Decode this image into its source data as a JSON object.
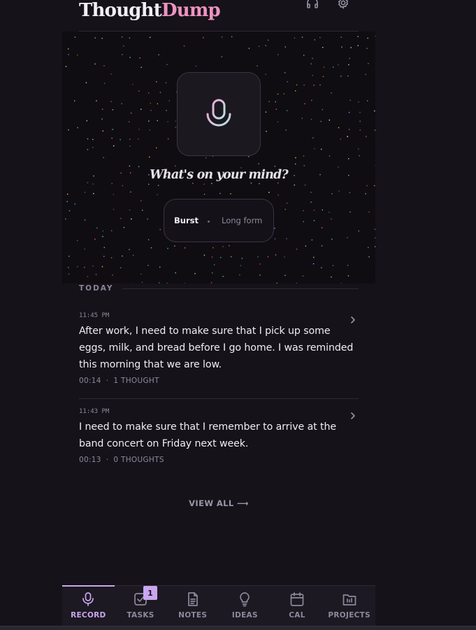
{
  "app": {
    "logo_part1": "Thought",
    "logo_part2": "Dump"
  },
  "header": {
    "icons": [
      "headphones-icon",
      "gear-icon"
    ]
  },
  "hero": {
    "prompt": "What's on your mind?",
    "mic_icon": "microphone-icon",
    "modes": [
      "Burst",
      "Long form"
    ],
    "selected_mode": "Burst"
  },
  "section": {
    "label": "TODAY"
  },
  "entries": [
    {
      "time": "11:45 PM",
      "text": "After work, I need to make sure that I pick up some eggs, milk, and bread before I go home. I was reminded this morning that we are low.",
      "duration": "00:14",
      "separator": "·",
      "thoughts": "1 THOUGHT"
    },
    {
      "time": "11:43 PM",
      "text": "I need to make sure that I remember to arrive at the band concert on Friday next week.",
      "duration": "00:13",
      "separator": "·",
      "thoughts": "0 THOUGHTS"
    }
  ],
  "view_all": "VIEW ALL ⟶",
  "nav": {
    "items": [
      {
        "label": "RECORD",
        "icon": "microphone-icon",
        "active": true
      },
      {
        "label": "TASKS",
        "icon": "checkbox-icon",
        "badge": "1"
      },
      {
        "label": "NOTES",
        "icon": "document-icon"
      },
      {
        "label": "IDEAS",
        "icon": "lightbulb-icon"
      },
      {
        "label": "CAL",
        "icon": "calendar-icon"
      },
      {
        "label": "PROJECTS",
        "icon": "folder-icon"
      }
    ]
  },
  "colors": {
    "background": "#15121a",
    "accent": "#c9a6ee",
    "logo_pink": "#ef93c1",
    "mic_gradient": [
      "#f0a6d6",
      "#b0e8e0"
    ]
  }
}
